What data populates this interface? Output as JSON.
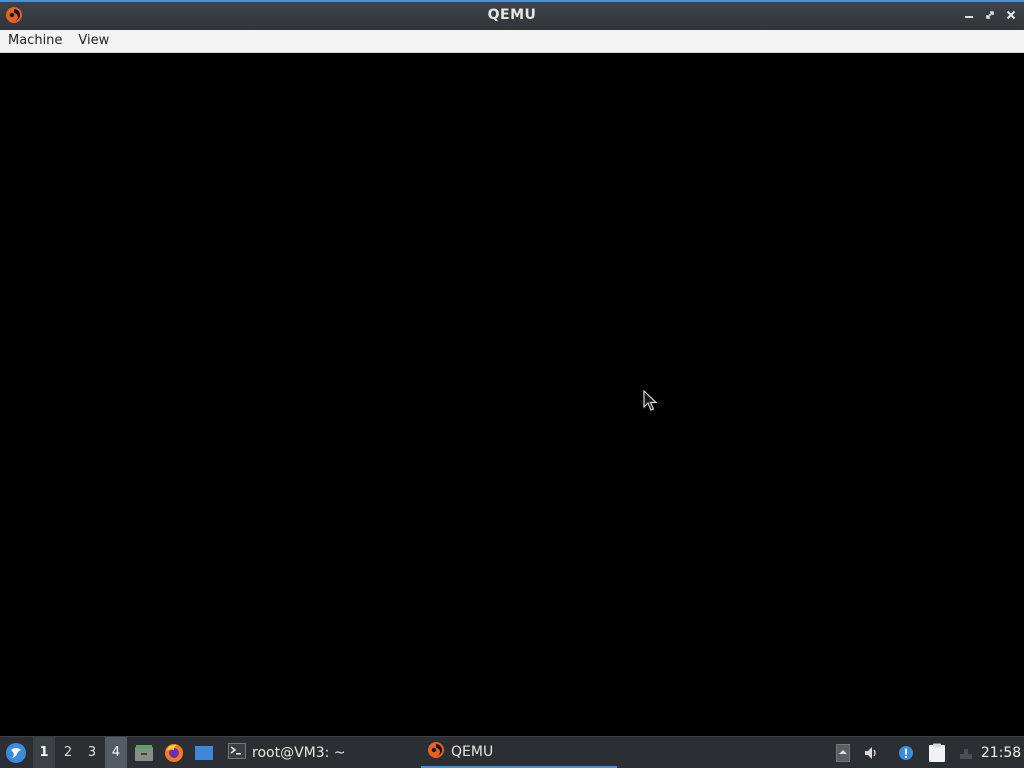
{
  "window": {
    "title": "QEMU",
    "icons": {
      "app": "qemu-icon",
      "minimize": "minimize-icon",
      "maximize": "maximize-icon",
      "close": "close-icon"
    }
  },
  "menubar": {
    "items": [
      "Machine",
      "View"
    ]
  },
  "vm_display": {
    "background": "#000000"
  },
  "taskbar": {
    "start_icon": "linux-start-menu-icon",
    "workspaces": [
      "1",
      "2",
      "3",
      "4"
    ],
    "launchers": [
      "file-manager-icon",
      "firefox-icon",
      "desktop-icon"
    ],
    "tasks": [
      {
        "label": "root@VM3: ~",
        "icon": "terminal-icon"
      },
      {
        "label": "QEMU",
        "icon": "qemu-icon"
      }
    ],
    "tray_icons": [
      "tray-arrow-icon",
      "volume-icon",
      "notification-icon",
      "clipboard-icon",
      "network-icon"
    ],
    "clock": "21:58"
  },
  "colors": {
    "titlebar": "#33373c",
    "accent": "#4a90d9",
    "menubar": "#f3f3f3",
    "taskbar": "#2b2f33"
  }
}
